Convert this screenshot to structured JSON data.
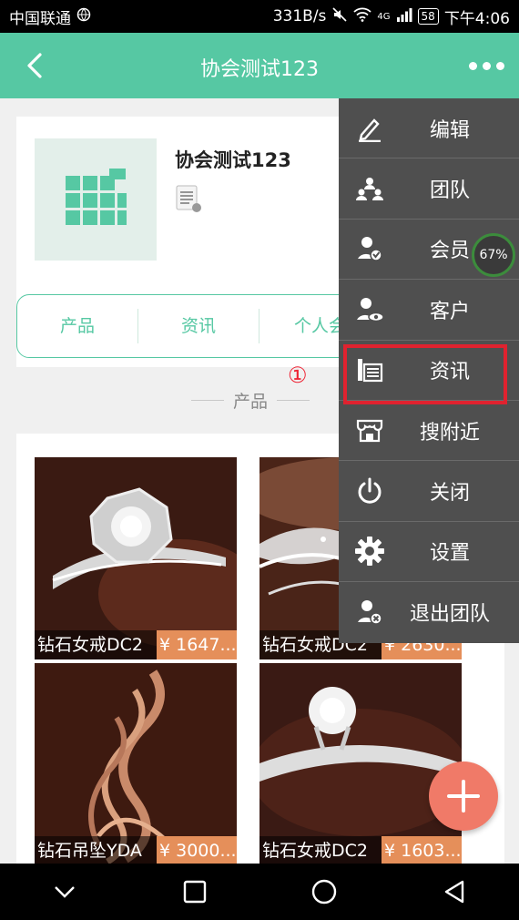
{
  "status_bar": {
    "carrier": "中国联通",
    "speed": "331B/s",
    "network": "4G",
    "battery": "58",
    "time": "下午4:06"
  },
  "header": {
    "title": "协会测试123"
  },
  "profile": {
    "name": "协会测试123"
  },
  "tabs": [
    "产品",
    "资讯",
    "个人会"
  ],
  "section_title": "产品",
  "annotation": "①",
  "products": [
    {
      "name": "钻石女戒DC2",
      "price": "¥ 1647..."
    },
    {
      "name": "钻石女戒DC2",
      "price": "¥ 2630..."
    },
    {
      "name": "钻石吊坠YDA",
      "price": "¥ 3000...."
    },
    {
      "name": "钻石女戒DC2",
      "price": "¥ 1603..."
    }
  ],
  "menu": [
    {
      "label": "编辑",
      "icon": "pencil-icon"
    },
    {
      "label": "团队",
      "icon": "team-icon"
    },
    {
      "label": "会员",
      "icon": "member-icon"
    },
    {
      "label": "客户",
      "icon": "customer-icon"
    },
    {
      "label": "资讯",
      "icon": "news-icon"
    },
    {
      "label": "搜附近",
      "icon": "nearby-icon"
    },
    {
      "label": "关闭",
      "icon": "power-icon"
    },
    {
      "label": "设置",
      "icon": "gear-icon"
    },
    {
      "label": "退出团队",
      "icon": "exit-team-icon"
    }
  ],
  "progress_badge": "67%",
  "colors": {
    "primary": "#56c8a3",
    "menu_bg": "#4f4f4f",
    "highlight": "#e0222f",
    "price_bg": "#e58f5a",
    "fab": "#f07a68"
  }
}
